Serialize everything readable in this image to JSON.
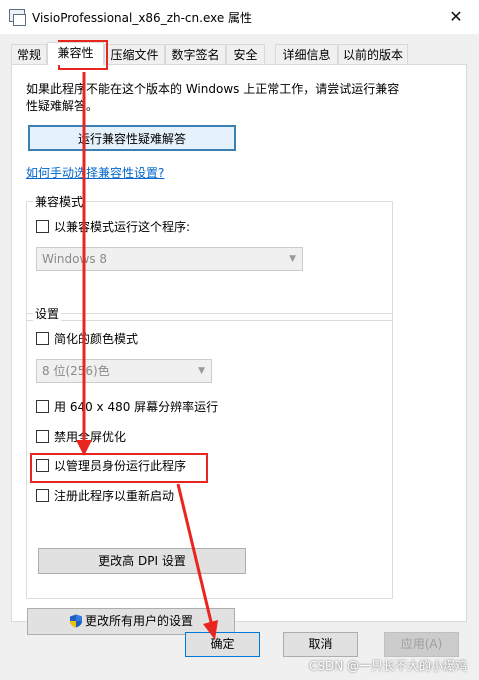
{
  "window": {
    "title": "VisioProfessional_x86_zh-cn.exe 属性",
    "close_glyph": "✕"
  },
  "tabs": [
    {
      "label": "常规"
    },
    {
      "label": "兼容性",
      "active": true
    },
    {
      "label": "压缩文件"
    },
    {
      "label": "数字签名"
    },
    {
      "label": "安全"
    },
    {
      "label": "详细信息"
    },
    {
      "label": "以前的版本"
    }
  ],
  "compat": {
    "description": "如果此程序不能在这个版本的 Windows 上正常工作，请尝试运行兼容性疑难解答。",
    "troubleshoot_button": "运行兼容性疑难解答",
    "manual_link": "如何手动选择兼容性设置?",
    "compat_mode": {
      "title": "兼容模式",
      "checkbox_label": "以兼容模式运行这个程序:",
      "os_select": "Windows 8"
    },
    "settings": {
      "title": "设置",
      "reduced_color": "简化的颜色模式",
      "color_select": "8 位(256)色",
      "res_640": "用 640 x 480 屏幕分辨率运行",
      "disable_fullscreen": "禁用全屏优化",
      "run_as_admin": "以管理员身份运行此程序",
      "register_restart": "注册此程序以重新启动",
      "dpi_button": "更改高 DPI 设置"
    },
    "all_users_button": "更改所有用户的设置"
  },
  "footer": {
    "ok": "确定",
    "cancel": "取消",
    "apply": "应用(A)"
  },
  "watermark": "CSDN @一只长不大的小爆鸡",
  "icons": {
    "app": "app-window-icon",
    "shield": "uac-shield-icon",
    "chevron": "chevron-down-icon",
    "close": "close-icon"
  },
  "colors": {
    "annotation": "#e8261f",
    "link": "#0066cc",
    "focus": "#3c7fb1"
  }
}
